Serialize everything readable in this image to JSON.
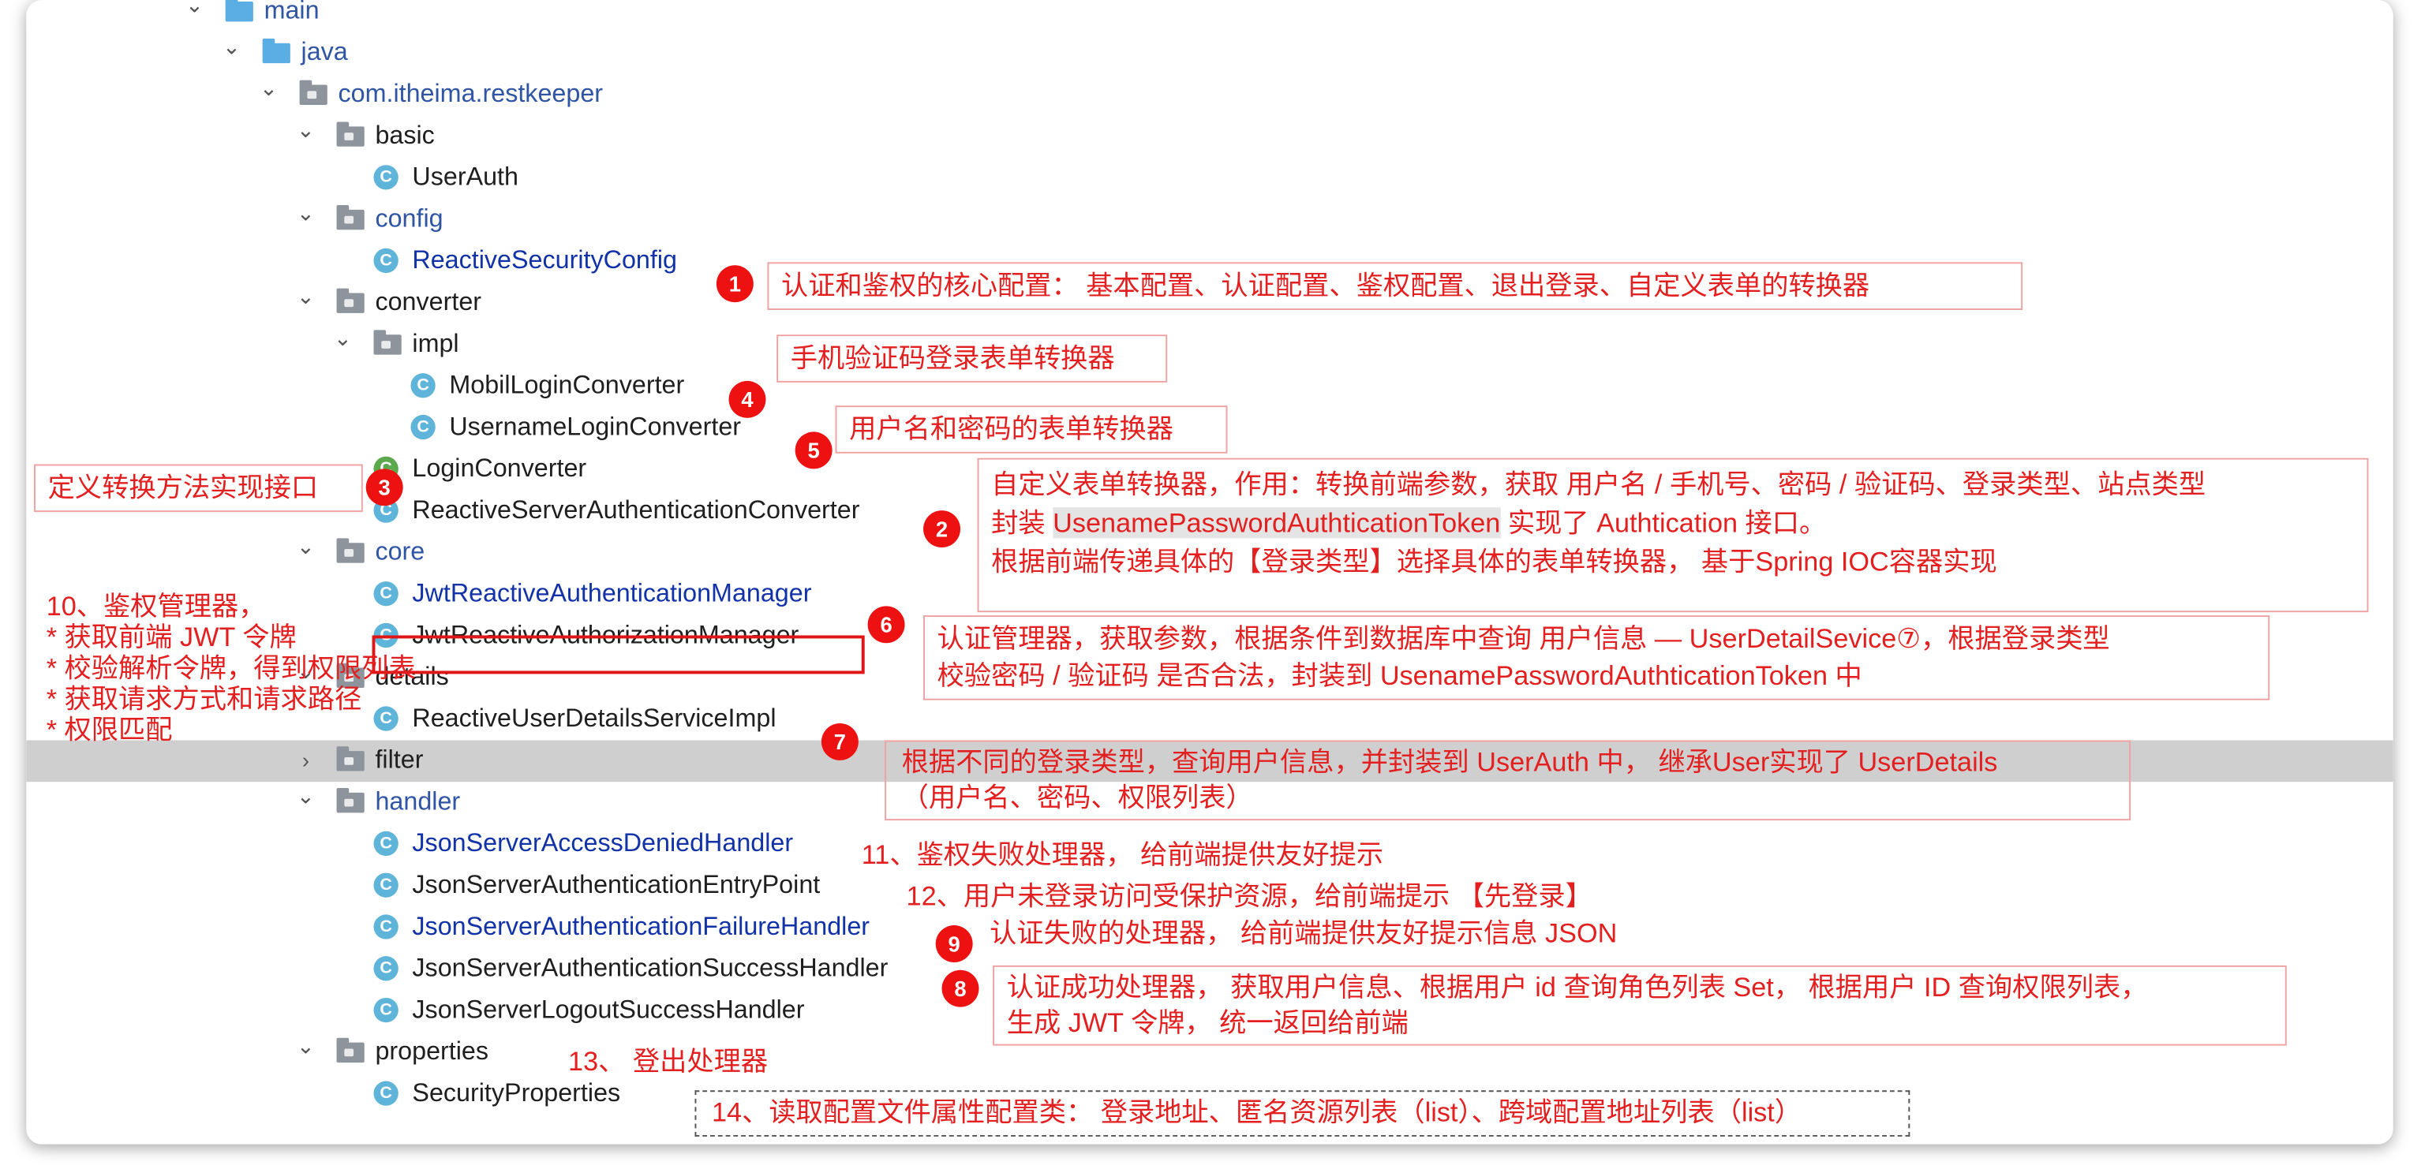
{
  "tree": [
    {
      "label": "main",
      "indent": 0,
      "kind": "blue-folder",
      "chevron": "down",
      "style": "pkg"
    },
    {
      "label": "java",
      "indent": 1,
      "kind": "blue-folder",
      "chevron": "down",
      "style": "pkg"
    },
    {
      "label": "com.itheima.restkeeper",
      "indent": 2,
      "kind": "package",
      "chevron": "down",
      "style": "pkg"
    },
    {
      "label": "basic",
      "indent": 3,
      "kind": "package",
      "chevron": "down",
      "style": "plain"
    },
    {
      "label": "UserAuth",
      "indent": 4,
      "kind": "class",
      "style": "plain"
    },
    {
      "label": "config",
      "indent": 3,
      "kind": "package",
      "chevron": "down",
      "style": "pkg"
    },
    {
      "label": "ReactiveSecurityConfig",
      "indent": 4,
      "kind": "class",
      "style": "mod"
    },
    {
      "label": "converter",
      "indent": 3,
      "kind": "package",
      "chevron": "down",
      "style": "plain"
    },
    {
      "label": "impl",
      "indent": 4,
      "kind": "package",
      "chevron": "down",
      "style": "plain"
    },
    {
      "label": "MobilLoginConverter",
      "indent": 5,
      "kind": "class",
      "style": "plain"
    },
    {
      "label": "UsernameLoginConverter",
      "indent": 5,
      "kind": "class",
      "style": "plain"
    },
    {
      "label": "LoginConverter",
      "indent": 4,
      "kind": "interface",
      "style": "plain"
    },
    {
      "label": "ReactiveServerAuthenticationConverter",
      "indent": 4,
      "kind": "class",
      "style": "plain"
    },
    {
      "label": "core",
      "indent": 3,
      "kind": "package",
      "chevron": "down",
      "style": "pkg"
    },
    {
      "label": "JwtReactiveAuthenticationManager",
      "indent": 4,
      "kind": "class",
      "style": "mod"
    },
    {
      "label": "JwtReactiveAuthorizationManager",
      "indent": 4,
      "kind": "class",
      "style": "plain"
    },
    {
      "label": "details",
      "indent": 3,
      "kind": "package",
      "chevron": "down",
      "style": "plain"
    },
    {
      "label": "ReactiveUserDetailsServiceImpl",
      "indent": 4,
      "kind": "class",
      "style": "plain"
    },
    {
      "label": "filter",
      "indent": 3,
      "kind": "package",
      "chevron": "right",
      "style": "plain",
      "selected": true
    },
    {
      "label": "handler",
      "indent": 3,
      "kind": "package",
      "chevron": "down",
      "style": "pkg"
    },
    {
      "label": "JsonServerAccessDeniedHandler",
      "indent": 4,
      "kind": "class",
      "style": "mod"
    },
    {
      "label": "JsonServerAuthenticationEntryPoint",
      "indent": 4,
      "kind": "class",
      "style": "plain"
    },
    {
      "label": "JsonServerAuthenticationFailureHandler",
      "indent": 4,
      "kind": "class",
      "style": "mod"
    },
    {
      "label": "JsonServerAuthenticationSuccessHandler",
      "indent": 4,
      "kind": "class",
      "style": "plain"
    },
    {
      "label": "JsonServerLogoutSuccessHandler",
      "indent": 4,
      "kind": "class",
      "style": "plain"
    },
    {
      "label": "properties",
      "indent": 3,
      "kind": "package",
      "chevron": "down",
      "style": "plain"
    },
    {
      "label": "SecurityProperties",
      "indent": 4,
      "kind": "class",
      "style": "plain"
    }
  ],
  "icons": {
    "chevron_down": "⌄",
    "chevron_right": "›",
    "class_letter": "C"
  },
  "badges": [
    "1",
    "2",
    "3",
    "4",
    "5",
    "6",
    "7",
    "8",
    "9"
  ],
  "annotations": {
    "a1": "认证和鉴权的核心配置： 基本配置、认证配置、鉴权配置、退出登录、自定义表单的转换器",
    "a4": "手机验证码登录表单转换器",
    "a5": "用户名和密码的表单转换器",
    "a3": "定义转换方法实现接口",
    "a2_line1": "自定义表单转换器，作用：转换前端参数，获取 用户名 / 手机号、密码 / 验证码、登录类型、站点类型",
    "a2_line2_pre": "封装 ",
    "a2_line2_token": "UsenamePasswordAuthticationToken",
    "a2_line2_post": " 实现了 Authtication 接口。",
    "a2_line3": "根据前端传递具体的【登录类型】选择具体的表单转换器， 基于Spring IOC容器实现",
    "a10_title": "10、鉴权管理器，",
    "a10_l1": "* 获取前端 JWT 令牌",
    "a10_l2": "* 校验解析令牌，得到权限列表",
    "a10_l3": "* 获取请求方式和请求路径",
    "a10_l4": "* 权限匹配",
    "a6_line1": "认证管理器，获取参数，根据条件到数据库中查询 用户信息 — UserDetailSevice⑦，根据登录类型",
    "a6_line2": "校验密码 / 验证码 是否合法，封装到 UsenamePasswordAuthticationToken 中",
    "a7_line1": "根据不同的登录类型，查询用户信息，并封装到 UserAuth 中， 继承User实现了 UserDetails",
    "a7_line2": "（用户名、密码、权限列表）",
    "a11": "11、鉴权失败处理器， 给前端提供友好提示",
    "a12": "12、用户未登录访问受保护资源，给前端提示 【先登录】",
    "a9": "认证失败的处理器， 给前端提供友好提示信息 JSON",
    "a8_line1": "认证成功处理器， 获取用户信息、根据用户 id 查询角色列表 Set， 根据用户 ID 查询权限列表，",
    "a8_line2": "生成 JWT 令牌， 统一返回给前端",
    "a13": "13、 登出处理器",
    "a14": "14、读取配置文件属性配置类： 登录地址、匿名资源列表（list）、跨域配置地址列表（list）"
  },
  "colors": {
    "annotation_red": "#e41f1f",
    "badge_red": "#ee1111",
    "package_blue": "#2f55a4",
    "class_icon": "#5fb4d9",
    "selected_row": "#cfcfcf"
  }
}
